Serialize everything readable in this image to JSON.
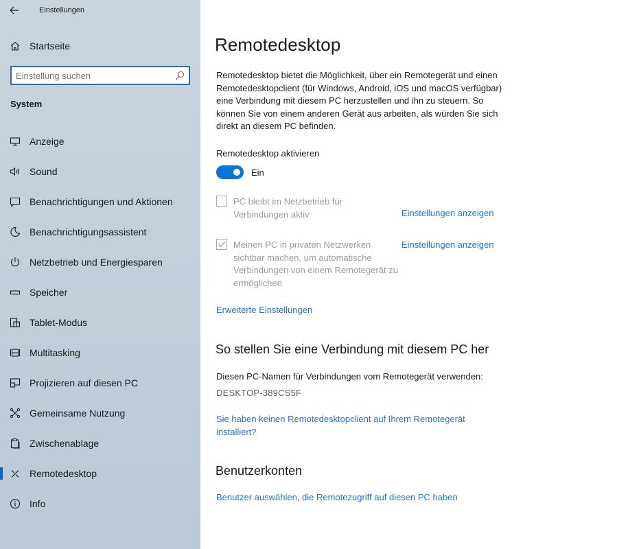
{
  "window": {
    "title": "Einstellungen"
  },
  "sidebar": {
    "home_label": "Startseite",
    "search_placeholder": "Einstellung suchen",
    "section_title": "System",
    "items": [
      {
        "label": "Anzeige",
        "icon": "display-icon"
      },
      {
        "label": "Sound",
        "icon": "speaker-icon"
      },
      {
        "label": "Benachrichtigungen und Aktionen",
        "icon": "notification-icon"
      },
      {
        "label": "Benachrichtigungsassistent",
        "icon": "moon-icon"
      },
      {
        "label": "Netzbetrieb und Energiesparen",
        "icon": "power-icon"
      },
      {
        "label": "Speicher",
        "icon": "storage-icon"
      },
      {
        "label": "Tablet-Modus",
        "icon": "tablet-mode-icon"
      },
      {
        "label": "Multitasking",
        "icon": "multitasking-icon"
      },
      {
        "label": "Projizieren auf diesen PC",
        "icon": "project-icon"
      },
      {
        "label": "Gemeinsame Nutzung",
        "icon": "shared-experiences-icon"
      },
      {
        "label": "Zwischenablage",
        "icon": "clipboard-icon"
      },
      {
        "label": "Remotedesktop",
        "icon": "remote-desktop-icon",
        "active": true
      },
      {
        "label": "Info",
        "icon": "info-icon"
      }
    ],
    "accent_color": "#0a64c2"
  },
  "main": {
    "title": "Remotedesktop",
    "description": "Remotedesktop bietet die Möglichkeit, über ein Remotegerät und einen Remotedesktopclient (für Windows, Android, iOS und macOS verfügbar) eine Verbindung mit diesem PC herzustellen und ihn zu steuern. So können Sie von einem anderen Gerät aus arbeiten, als würden Sie sich direkt an diesem PC befinden.",
    "toggle": {
      "label": "Remotedesktop aktivieren",
      "state_label": "Ein",
      "on": true,
      "color": "#0a74d8"
    },
    "options": [
      {
        "text": "PC bleibt im Netzbetrieb für Verbindungen aktiv",
        "checked": false,
        "disabled": true,
        "link": "Einstellungen anzeigen"
      },
      {
        "text": "Meinen PC in privaten Netzwerken sichtbar machen, um automatische Verbindungen von einem Remotegerät zu ermöglichen",
        "checked": true,
        "disabled": true,
        "link": "Einstellungen anzeigen"
      }
    ],
    "advanced_link": "Erweiterte Einstellungen",
    "connect_section": {
      "heading": "So stellen Sie eine Verbindung mit diesem PC her",
      "instruction": "Diesen PC-Namen für Verbindungen vom Remotegerät verwenden:",
      "pc_name": "DESKTOP-389CS5F",
      "client_link": "Sie haben keinen Remotedesktopclient auf Ihrem Remotegerät installiert?"
    },
    "accounts_section": {
      "heading": "Benutzerkonten",
      "link": "Benutzer auswählen, die Remotezugriff auf diesen PC haben"
    },
    "link_color": "#1f74c6"
  }
}
